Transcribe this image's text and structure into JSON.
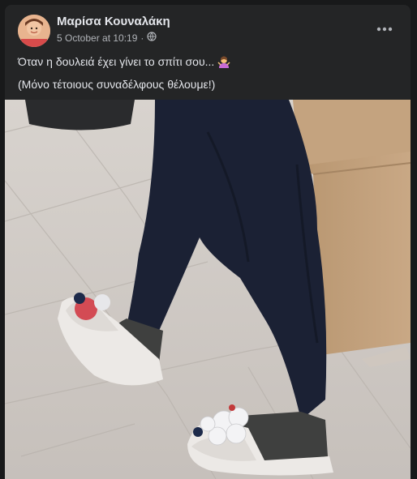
{
  "post": {
    "author": "Μαρίσα Κουναλάκη",
    "timestamp": "5 October at 10:19",
    "separator": "·",
    "line1": "Όταν η δουλειά έχει γίνει το σπίτι σου...",
    "line2": "(Μόνο τέτοιους συναδέλφους θέλουμε!)"
  },
  "icons": {
    "privacy": "globe-icon",
    "more": "more-options-icon",
    "emoji": "woman-shrugging-emoji"
  },
  "colors": {
    "background": "#18191a",
    "card": "#242526",
    "primary_text": "#e4e6eb",
    "secondary_text": "#b0b3b8"
  }
}
